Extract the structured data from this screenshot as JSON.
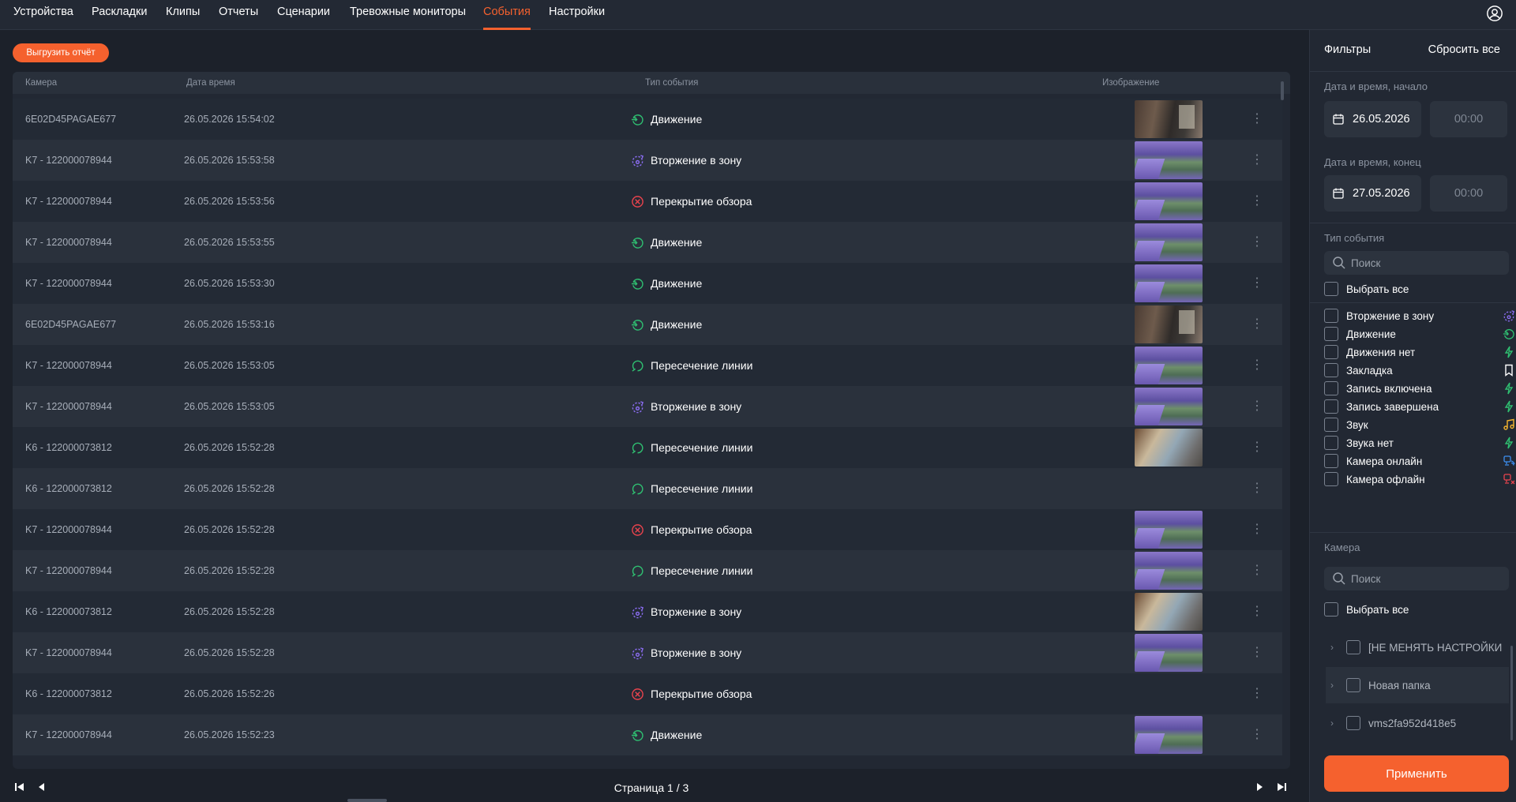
{
  "nav": {
    "tabs": [
      {
        "label": "Устройства"
      },
      {
        "label": "Раскладки"
      },
      {
        "label": "Клипы"
      },
      {
        "label": "Отчеты"
      },
      {
        "label": "Сценарии"
      },
      {
        "label": "Тревожные мониторы"
      },
      {
        "label": "События",
        "active": true
      },
      {
        "label": "Настройки"
      }
    ]
  },
  "toolbar": {
    "export_label": "Выгрузить отчёт"
  },
  "table": {
    "headers": {
      "camera": "Камера",
      "datetime": "Дата время",
      "event_type": "Тип события",
      "image": "Изображение"
    },
    "rows": [
      {
        "camera": "6E02D45PAGAE677",
        "datetime": "26.05.2026 15:54:02",
        "event": "Движение",
        "icon": "motion-icon",
        "thumb": "dark"
      },
      {
        "camera": "K7 - 122000078944",
        "datetime": "26.05.2026 15:53:58",
        "event": "Вторжение в зону",
        "icon": "zone-intrusion-icon",
        "thumb": "purple"
      },
      {
        "camera": "K7 - 122000078944",
        "datetime": "26.05.2026 15:53:56",
        "event": "Перекрытие обзора",
        "icon": "view-blocked-icon",
        "thumb": "purple"
      },
      {
        "camera": "K7 - 122000078944",
        "datetime": "26.05.2026 15:53:55",
        "event": "Движение",
        "icon": "motion-icon",
        "thumb": "purple"
      },
      {
        "camera": "K7 - 122000078944",
        "datetime": "26.05.2026 15:53:30",
        "event": "Движение",
        "icon": "motion-icon",
        "thumb": "purple"
      },
      {
        "camera": "6E02D45PAGAE677",
        "datetime": "26.05.2026 15:53:16",
        "event": "Движение",
        "icon": "motion-icon",
        "thumb": "dark"
      },
      {
        "camera": "K7 - 122000078944",
        "datetime": "26.05.2026 15:53:05",
        "event": "Пересечение линии",
        "icon": "line-crossing-icon",
        "thumb": "purple"
      },
      {
        "camera": "K7 - 122000078944",
        "datetime": "26.05.2026 15:53:05",
        "event": "Вторжение в зону",
        "icon": "zone-intrusion-icon",
        "thumb": "purple"
      },
      {
        "camera": "K6 - 122000073812",
        "datetime": "26.05.2026 15:52:28",
        "event": "Пересечение линии",
        "icon": "line-crossing-icon",
        "thumb": "patio"
      },
      {
        "camera": "K6 - 122000073812",
        "datetime": "26.05.2026 15:52:28",
        "event": "Пересечение линии",
        "icon": "line-crossing-icon",
        "thumb": ""
      },
      {
        "camera": "K7 - 122000078944",
        "datetime": "26.05.2026 15:52:28",
        "event": "Перекрытие обзора",
        "icon": "view-blocked-icon",
        "thumb": "purple"
      },
      {
        "camera": "K7 - 122000078944",
        "datetime": "26.05.2026 15:52:28",
        "event": "Пересечение линии",
        "icon": "line-crossing-icon",
        "thumb": "purple"
      },
      {
        "camera": "K6 - 122000073812",
        "datetime": "26.05.2026 15:52:28",
        "event": "Вторжение в зону",
        "icon": "zone-intrusion-icon",
        "thumb": "patio"
      },
      {
        "camera": "K7 - 122000078944",
        "datetime": "26.05.2026 15:52:28",
        "event": "Вторжение в зону",
        "icon": "zone-intrusion-icon",
        "thumb": "purple"
      },
      {
        "camera": "K6 - 122000073812",
        "datetime": "26.05.2026 15:52:26",
        "event": "Перекрытие обзора",
        "icon": "view-blocked-icon",
        "thumb": ""
      },
      {
        "camera": "K7 - 122000078944",
        "datetime": "26.05.2026 15:52:23",
        "event": "Движение",
        "icon": "motion-icon",
        "thumb": "purple"
      }
    ]
  },
  "pager": {
    "label": "Страница 1 / 3"
  },
  "filters": {
    "title": "Фильтры",
    "reset_label": "Сбросить все",
    "start_label": "Дата и время, начало",
    "start_date": "26.05.2026",
    "start_time": "00:00",
    "end_label": "Дата и время, конец",
    "end_date": "27.05.2026",
    "end_time": "00:00",
    "event_type_label": "Тип события",
    "event_search_placeholder": "Поиск",
    "select_all_label": "Выбрать все",
    "event_types": [
      {
        "label": "Вторжение в зону",
        "icon": "zone-intrusion-icon",
        "color": "#8a6cf0"
      },
      {
        "label": "Движение",
        "icon": "motion-icon",
        "color": "#2fbf71"
      },
      {
        "label": "Движения нет",
        "icon": "lightning-icon",
        "color": "#2fbf71"
      },
      {
        "label": "Закладка",
        "icon": "bookmark-icon",
        "color": "#ffffff"
      },
      {
        "label": "Запись включена",
        "icon": "lightning-icon",
        "color": "#2fbf71"
      },
      {
        "label": "Запись завершена",
        "icon": "lightning-icon",
        "color": "#2fbf71"
      },
      {
        "label": "Звук",
        "icon": "music-note-icon",
        "color": "#f5b52e"
      },
      {
        "label": "Звука нет",
        "icon": "lightning-icon",
        "color": "#2fbf71"
      },
      {
        "label": "Камера онлайн",
        "icon": "camera-online-icon",
        "color": "#3d8ff0"
      },
      {
        "label": "Камера офлайн",
        "icon": "camera-offline-icon",
        "color": "#e8434d"
      }
    ],
    "camera_label": "Камера",
    "camera_search_placeholder": "Поиск",
    "camera_select_all_label": "Выбрать все",
    "camera_tree": [
      {
        "label": "[НЕ МЕНЯТЬ НАСТРОЙКИ"
      },
      {
        "label": "Новая папка"
      },
      {
        "label": "vms2fa952d418e5"
      }
    ],
    "apply_label": "Применить"
  },
  "colors": {
    "accent": "#f5612e",
    "motion": "#2fbf71",
    "zone": "#8a6cf0",
    "blocked": "#e8434d"
  }
}
